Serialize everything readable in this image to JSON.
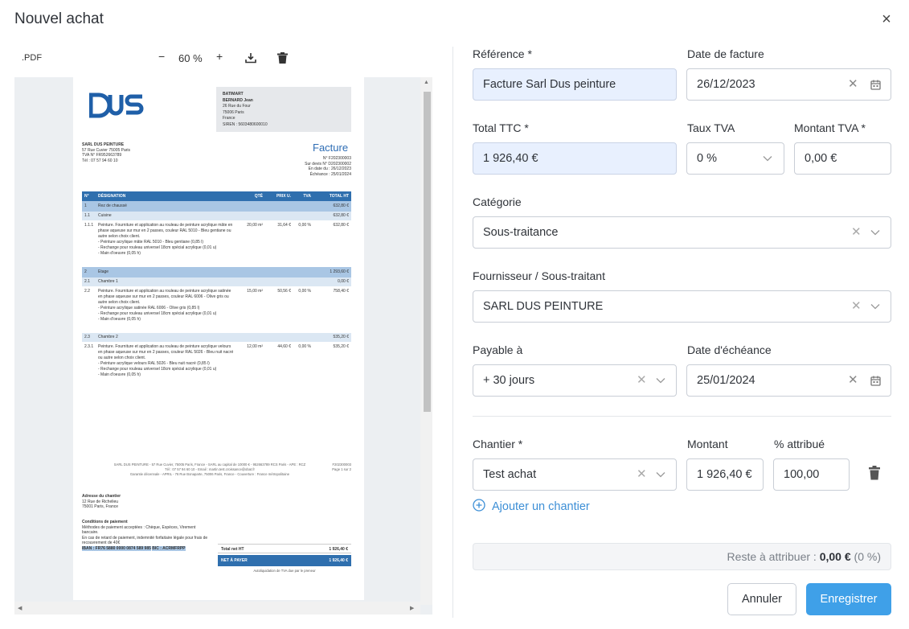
{
  "dialog": {
    "title": "Nouvel achat",
    "close_glyph": "×"
  },
  "viewer": {
    "file_type": ".PDF",
    "zoom_out": "−",
    "zoom": "60 %",
    "zoom_in": "+",
    "icons": [
      "download-icon",
      "trash-icon"
    ]
  },
  "document": {
    "logo_text": "DUS",
    "supplier_box": [
      "BATIMART",
      "BERNARD Jean",
      "26 Rue du Four",
      "75006 Paris",
      "France",
      "SIREN : 5603480600010"
    ],
    "issuer": [
      "SARL DUS PEINTURE",
      "57 Rue Cuvier 75005 Paris",
      "TVA N° FR952663789",
      "Tél : 07 57 94 60 10"
    ],
    "title": "Facture",
    "meta": [
      "N° F202300003",
      "Sur devis N° D202300002",
      "En date du : 26/12/2023",
      "Échéance : 25/01/2024"
    ],
    "table_header": [
      "N°",
      "DÉSIGNATION",
      "QTÉ",
      "PRIX U.",
      "TVA",
      "TOTAL HT"
    ],
    "rows": [
      {
        "kind": "section",
        "n": "1",
        "label": "Rez de chaussé",
        "total": "632,80 €"
      },
      {
        "kind": "sub",
        "n": "1.1",
        "label": "Cuisine",
        "total": "632,80 €"
      },
      {
        "kind": "item",
        "n": "1.1.1",
        "label": "Peinture. Fourniture et application au rouleau de peinture acrylique mâte en phase aqueuse sur mur en 2 passes, couleur RAL 5010 - Bleu gentiane ou autre selon choix client.",
        "details": [
          "- Peinture acrylique mâte RAL 5010 - Bleu gentiane (0,85 l)",
          "- Rechange pour rouleau universel 18cm spécial acrylique (0,01 u)",
          "- Main d'oeuvre (0,05 h)"
        ],
        "qty": "20,00 m²",
        "price": "31,64 €",
        "tva": "0,00 %",
        "total": "632,80 €"
      },
      {
        "kind": "section",
        "n": "2",
        "label": "Etage",
        "total": "1 293,60 €"
      },
      {
        "kind": "sub",
        "n": "2.1",
        "label": "Chambre 1",
        "total": "0,00 €"
      },
      {
        "kind": "item",
        "n": "2.2",
        "label": "Peinture. Fourniture et application au rouleau de peinture acrylique satinée en phase aqueuse sur mur en 2 passes, couleur RAL 6006 - Olive gris ou autre selon choix client.",
        "details": [
          "- Peinture acrylique satinée RAL 6006 - Olive gris (0,85 l)",
          "- Rechange pour rouleau universel 18cm spécial acrylique (0,01 u)",
          "- Main d'oeuvre (0,05 h)"
        ],
        "qty": "15,00 m²",
        "price": "50,56 €",
        "tva": "0,00 %",
        "total": "758,40 €"
      },
      {
        "kind": "sub",
        "n": "2.3",
        "label": "Chambre 2",
        "total": "535,20 €"
      },
      {
        "kind": "item",
        "n": "2.3.1",
        "label": "Peinture. Fourniture et application au rouleau de peinture acrylique velours en phase aqueuse sur mur en 2 passes, couleur RAL 5026 - Bleu nuit nacré ou autre selon choix client.",
        "details": [
          "- Peinture acrylique velours RAL 5026 - Bleu nuit nacré (0,85 l)",
          "- Rechange pour rouleau universel 18cm spécial acrylique (0,01 u)",
          "- Main d'oeuvre (0,05 h)"
        ],
        "qty": "12,00 m²",
        "price": "44,60 €",
        "tva": "0,00 %",
        "total": "535,20 €"
      }
    ],
    "footer_lines": [
      "SARL DUS PEINTURE - 57 Rue Cuvier, 75005 Paris, France - SARL au capital de 10000 € - 952663789 RCS Paris - APE : RCZ",
      "Tél : 07 57 94 60 10 - Email : martin.test.croissance@obat.fr",
      "Garantie décennale - APRIL - 76 Rue Bonaparte, 75006 Paris, France - Couverture : France métropolitaine"
    ],
    "footer_ref": [
      "F202300003",
      "Page 1 sur 2"
    ],
    "site_title": "Adresse du chantier",
    "site_lines": [
      "12 Rue de Richelieu",
      "75001 Paris, France"
    ],
    "payment_title": "Conditions de paiement",
    "payment_lines": [
      "Méthodes de paiement acceptées : Chèque, Espèces, Virement bancaire.",
      "En cas de retard de paiement, indemnité forfaitaire légale pour frais de recouvrement de 40€"
    ],
    "iban": "IBAN : FR76 5880 0000 0874 589 985",
    "bic": "BIC : ACRMFRPP",
    "total_net_label": "Total net HT",
    "total_net_value": "1 926,40 €",
    "net_pay_label": "NET À PAYER",
    "net_pay_value": "1 926,40 €",
    "autoliq": "Autoliquidation de TVA due par le preneur"
  },
  "form": {
    "reference": {
      "label": "Référence *",
      "value": "Facture Sarl Dus peinture"
    },
    "invoice_date": {
      "label": "Date de facture",
      "value": "26/12/2023"
    },
    "total_ttc": {
      "label": "Total TTC *",
      "value": "1 926,40 €"
    },
    "vat_rate": {
      "label": "Taux TVA",
      "value": "0 %"
    },
    "vat_amount": {
      "label": "Montant TVA *",
      "value": "0,00 €"
    },
    "category": {
      "label": "Catégorie",
      "value": "Sous-traitance"
    },
    "supplier": {
      "label": "Fournisseur / Sous-traitant",
      "value": "SARL DUS PEINTURE"
    },
    "payable": {
      "label": "Payable à",
      "value": "+ 30 jours"
    },
    "due_date": {
      "label": "Date d'échéance",
      "value": "25/01/2024"
    },
    "site": {
      "label": "Chantier *",
      "value": "Test achat"
    },
    "amount": {
      "label": "Montant",
      "value": "1 926,40 €"
    },
    "percent": {
      "label": "% attribué",
      "value": "100,00"
    },
    "add_site": "Ajouter un chantier",
    "remaining_label": "Reste à attribuer :",
    "remaining_value": "0,00 €",
    "remaining_pct": "(0 %)",
    "cancel": "Annuler",
    "save": "Enregistrer"
  },
  "colors": {
    "primary": "#3fa0e8",
    "filled": "#e8f0fe",
    "doc_blue": "#2f6fae"
  }
}
